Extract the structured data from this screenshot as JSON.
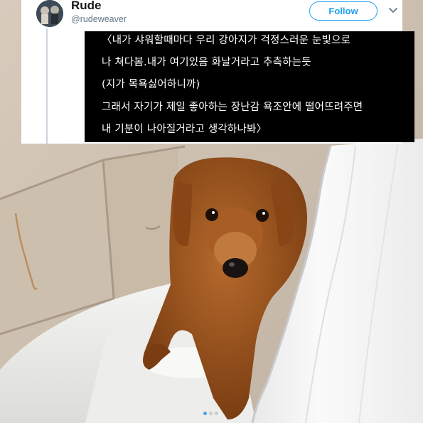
{
  "tweet": {
    "user_name": "Rude",
    "user_handle": "@rudeweaver",
    "follow_label": "Follow",
    "caption_lines": [
      "〈내가 샤워할때마다 우리 강아지가 걱정스러운 눈빛으로",
      "나 쳐다봄.내가 여기있음 화날거라고 추측하는듯",
      "(지가 목욕싫어하니까)",
      "그래서 자기가 제일 좋아하는 장난감 욕조안에 떨어뜨려주면",
      "내 기분이 나아질거라고 생각하나봐〉"
    ]
  },
  "icons": {
    "avatar": "profile-avatar",
    "menu": "chevron-down-icon"
  },
  "carousel": {
    "count": 3,
    "active_index": 0
  },
  "colors": {
    "accent": "#1da1f2",
    "active_dot": "#3897f0",
    "caption_bg": "#000000"
  }
}
